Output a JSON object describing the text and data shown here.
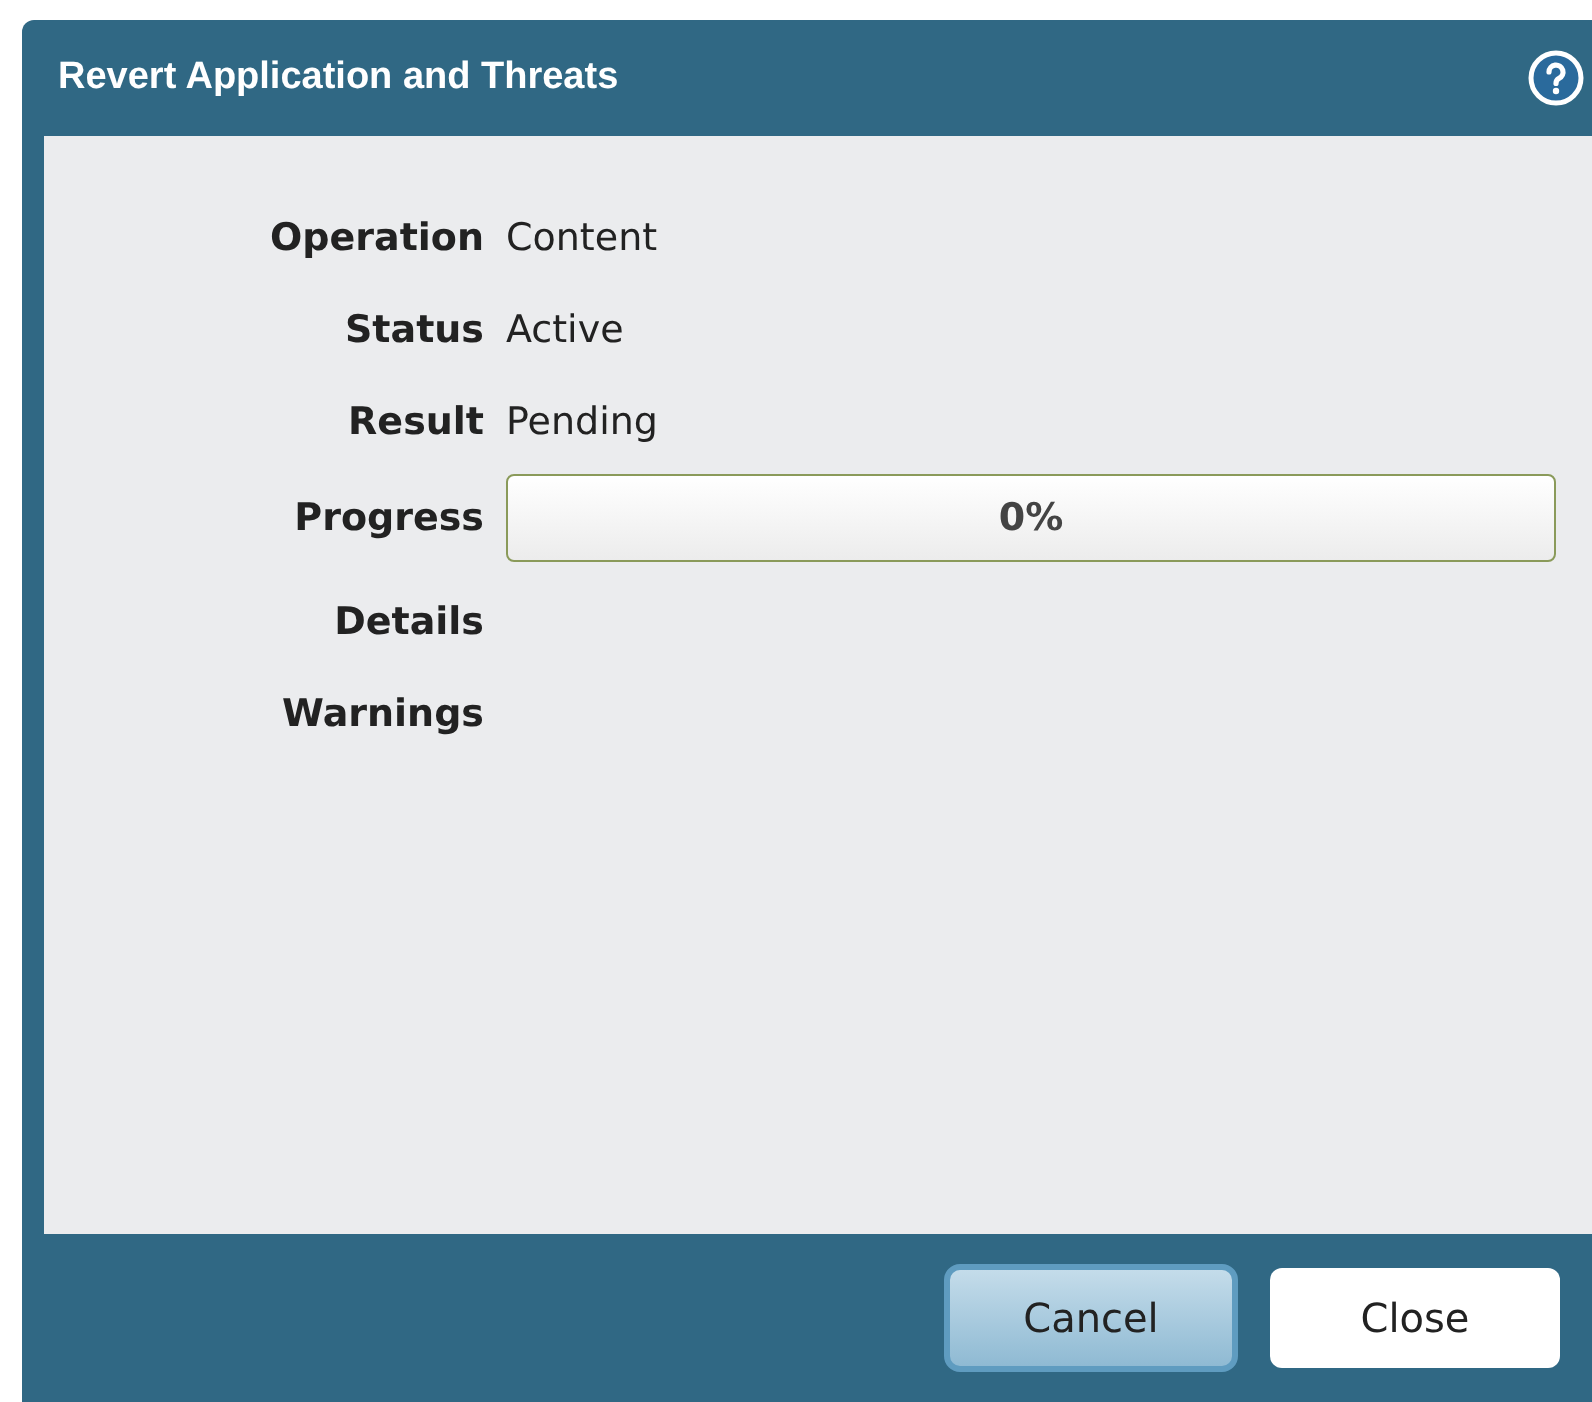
{
  "window": {
    "title": "Revert Application and Threats"
  },
  "fields": [
    {
      "label": "Operation",
      "kind": "text",
      "value": "Content"
    },
    {
      "label": "Status",
      "kind": "text",
      "value": "Active"
    },
    {
      "label": "Result",
      "kind": "text",
      "value": "Pending"
    },
    {
      "label": "Progress",
      "kind": "progress",
      "level": 0,
      "reading": "0%"
    },
    {
      "label": "Details",
      "kind": "text"
    },
    {
      "label": "Warnings",
      "kind": "text"
    }
  ],
  "buttons": [
    {
      "label": "Cancel",
      "focused": true
    },
    {
      "label": "Close",
      "focused": false
    }
  ]
}
